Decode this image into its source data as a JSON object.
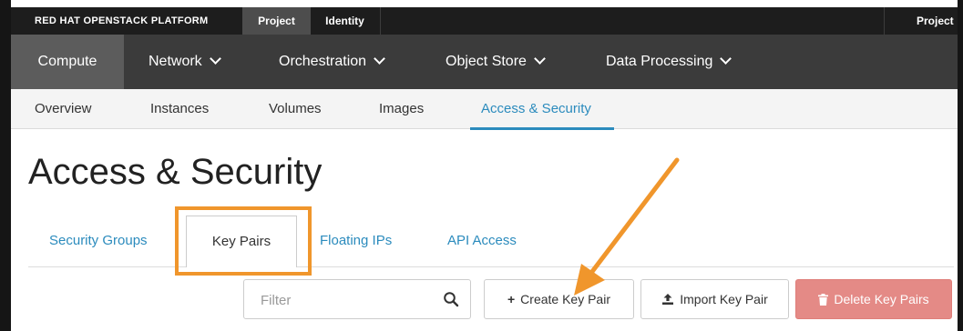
{
  "topbar": {
    "brand": "RED HAT OPENSTACK PLATFORM",
    "tabs": [
      {
        "label": "Project"
      },
      {
        "label": "Identity"
      }
    ],
    "project_menu": "Project"
  },
  "mainnav": {
    "items": [
      {
        "label": "Compute"
      },
      {
        "label": "Network"
      },
      {
        "label": "Orchestration"
      },
      {
        "label": "Object Store"
      },
      {
        "label": "Data Processing"
      }
    ]
  },
  "subnav": {
    "items": [
      {
        "label": "Overview"
      },
      {
        "label": "Instances"
      },
      {
        "label": "Volumes"
      },
      {
        "label": "Images"
      },
      {
        "label": "Access & Security"
      }
    ]
  },
  "page": {
    "title": "Access & Security",
    "tabs": [
      {
        "label": "Security Groups"
      },
      {
        "label": "Key Pairs"
      },
      {
        "label": "Floating IPs"
      },
      {
        "label": "API Access"
      }
    ]
  },
  "toolbar": {
    "filter_placeholder": "Filter",
    "create_label": "Create Key Pair",
    "create_glyph": "+",
    "import_label": "Import Key Pair",
    "delete_label": "Delete Key Pairs"
  },
  "colors": {
    "accent": "#2b8bbd",
    "annotation": "#f0962c",
    "danger": "#e48a86"
  }
}
